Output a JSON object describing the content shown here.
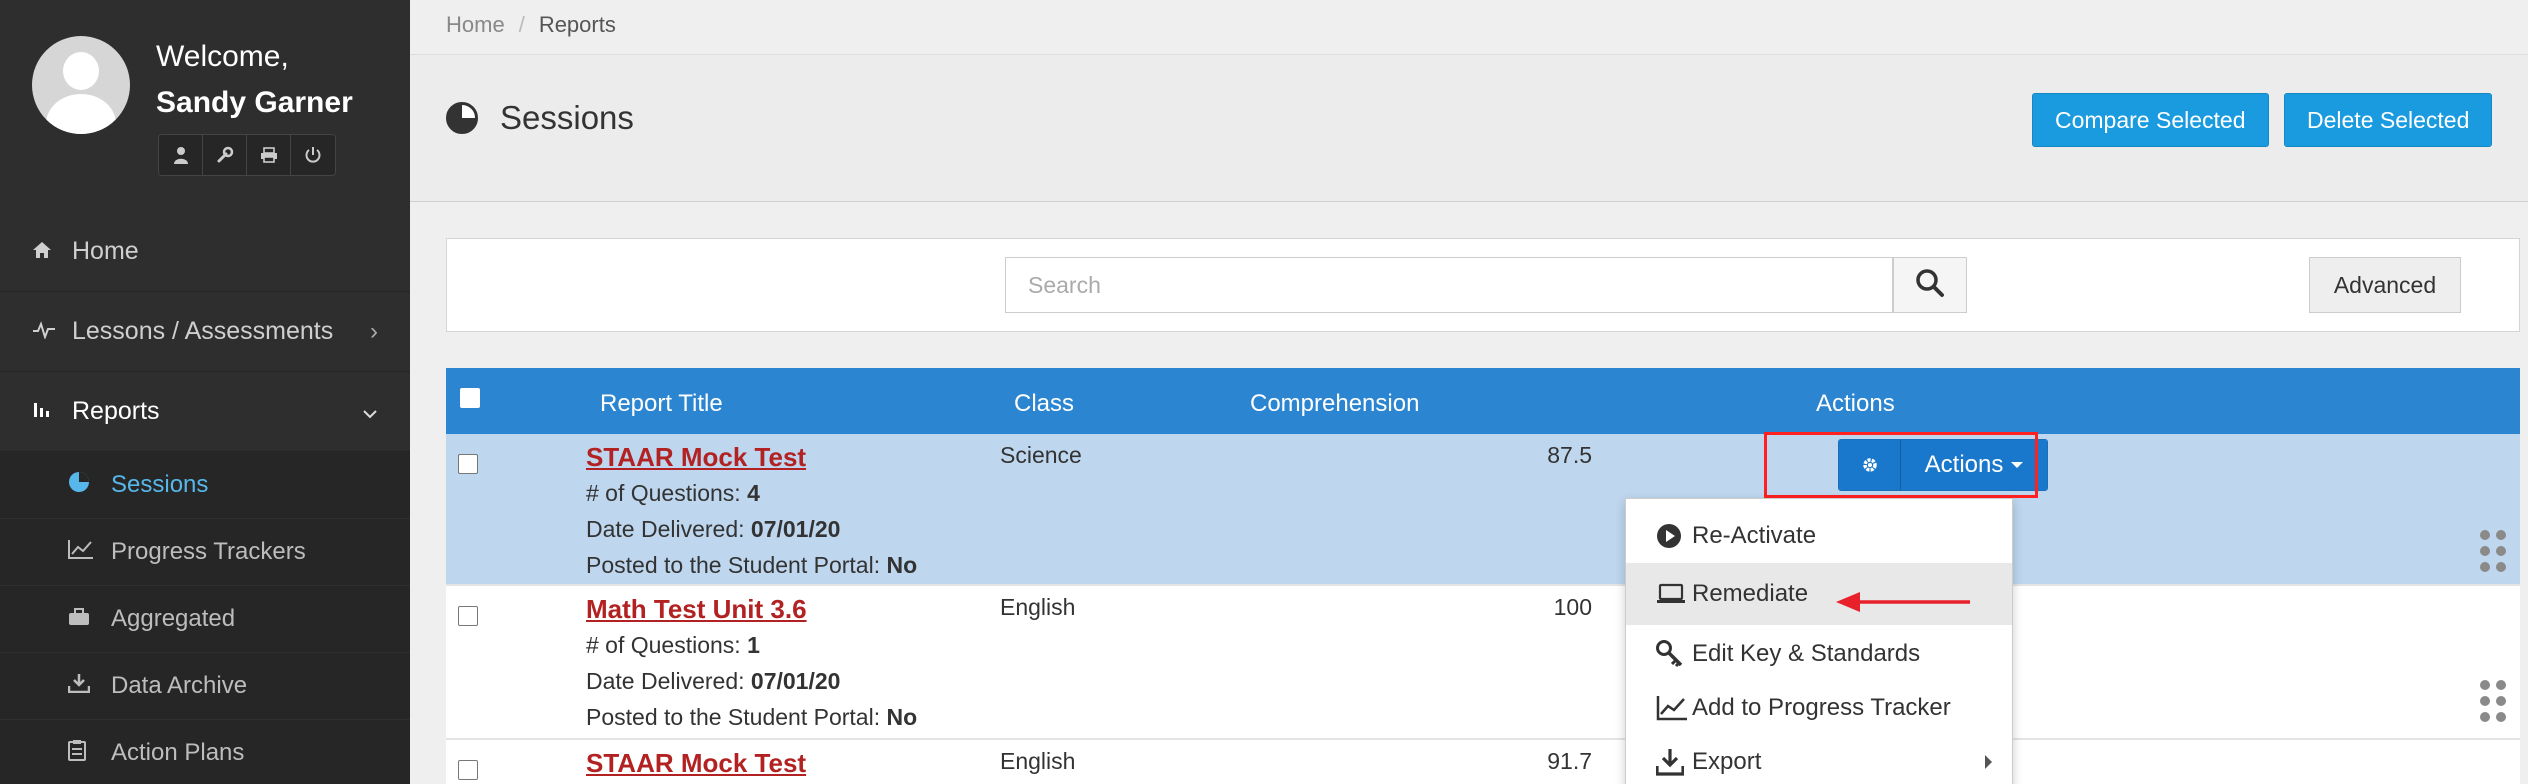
{
  "user": {
    "welcome": "Welcome,",
    "name": "Sandy Garner"
  },
  "nav": {
    "home": "Home",
    "lessons": "Lessons / Assessments",
    "reports": "Reports",
    "sub": [
      "Sessions",
      "Progress Trackers",
      "Aggregated",
      "Data Archive",
      "Action Plans"
    ]
  },
  "breadcrumb": {
    "home": "Home",
    "separator": "/",
    "current": "Reports"
  },
  "page": {
    "title": "Sessions"
  },
  "toolbar": {
    "compare": "Compare Selected",
    "delete": "Delete Selected"
  },
  "search": {
    "placeholder": "Search",
    "advanced": "Advanced"
  },
  "table": {
    "headers": {
      "title": "Report Title",
      "class": "Class",
      "comprehension": "Comprehension",
      "actions": "Actions"
    },
    "rows": [
      {
        "title": "STAAR Mock Test",
        "questions_label": "# of Questions:",
        "questions": "4",
        "date_label": "Date Delivered:",
        "date": "07/01/20",
        "portal_label": "Posted to the Student Portal:",
        "portal": "No",
        "class": "Science",
        "comprehension": "87.5"
      },
      {
        "title": "Math Test Unit 3.6",
        "questions_label": "# of Questions:",
        "questions": "1",
        "date_label": "Date Delivered:",
        "date": "07/01/20",
        "portal_label": "Posted to the Student Portal:",
        "portal": "No",
        "class": "English",
        "comprehension": "100"
      },
      {
        "title": "STAAR Mock Test",
        "class": "English",
        "comprehension": "91.7"
      }
    ],
    "actions_label": "Actions"
  },
  "dropdown": {
    "items": [
      "Re-Activate",
      "Remediate",
      "Edit Key & Standards",
      "Add to Progress Tracker",
      "Export"
    ]
  },
  "colors": {
    "accent": "#1a9be0",
    "header": "#2b85d1",
    "highlight": "#ff2020",
    "link": "#b22222"
  }
}
